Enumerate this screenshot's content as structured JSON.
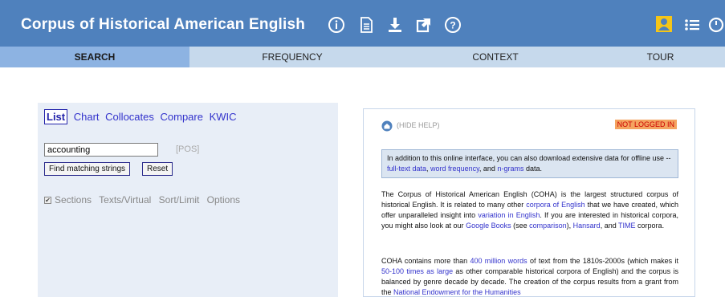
{
  "header": {
    "title": "Corpus of Historical American English",
    "icons": [
      "info-icon",
      "document-icon",
      "download-icon",
      "external-link-icon",
      "help-icon",
      "user-icon",
      "list-icon",
      "history-icon"
    ]
  },
  "nav": {
    "tabs": [
      {
        "label": "SEARCH",
        "active": true
      },
      {
        "label": "FREQUENCY",
        "active": false
      },
      {
        "label": "CONTEXT",
        "active": false
      },
      {
        "label": "TOUR",
        "active": false
      }
    ]
  },
  "search": {
    "modes": [
      "List",
      "Chart",
      "Collocates",
      "Compare",
      "KWIC"
    ],
    "selected_mode": "List",
    "word_value": "accounting",
    "pos_label": "[POS]",
    "find_button": "Find matching strings",
    "reset_button": "Reset",
    "options": [
      "Sections",
      "Texts/Virtual",
      "Sort/Limit",
      "Options"
    ]
  },
  "help": {
    "hide_label": "(HIDE HELP)",
    "login_status": "NOT LOGGED IN",
    "download": {
      "text1": "In addition to this online interface, you can also download extensive data for offline use -- ",
      "link1": "full-text data",
      "sep1": ", ",
      "link2": "word frequency",
      "sep2": ", and ",
      "link3": "n-grams",
      "text2": " data."
    },
    "para1": {
      "t1": "The Corpus of Historical American English (COHA) is the largest structured corpus of historical English. It is related to many other ",
      "l1": "corpora of English",
      "t2": " that we have created, which offer unparalleled insight into ",
      "l2": "variation in English",
      "t3": ". If you are interested in historical corpora, you might also look at our ",
      "l3": "Google Books",
      "t4": " (see ",
      "l4": "comparison",
      "t5": "), ",
      "l5": "Hansard",
      "t6": ", and ",
      "l6": "TIME",
      "t7": " corpora."
    },
    "para2": {
      "t1": "COHA contains more than ",
      "l1": "400 million words",
      "t2": " of text from the 1810s-2000s (which makes it ",
      "l2": "50-100 times as large",
      "t3": " as other comparable historical corpora of English) and the corpus is balanced by genre decade by decade. The creation of the corpus results from a grant from the ",
      "l3": "National Endowment for the Humanities"
    }
  },
  "colors": {
    "header_bg": "#4f81bd",
    "nav_bg": "#c6d9ec",
    "active_tab_bg": "#8db3e2",
    "link": "#3333cc",
    "login_badge_bg": "#f4a460"
  }
}
